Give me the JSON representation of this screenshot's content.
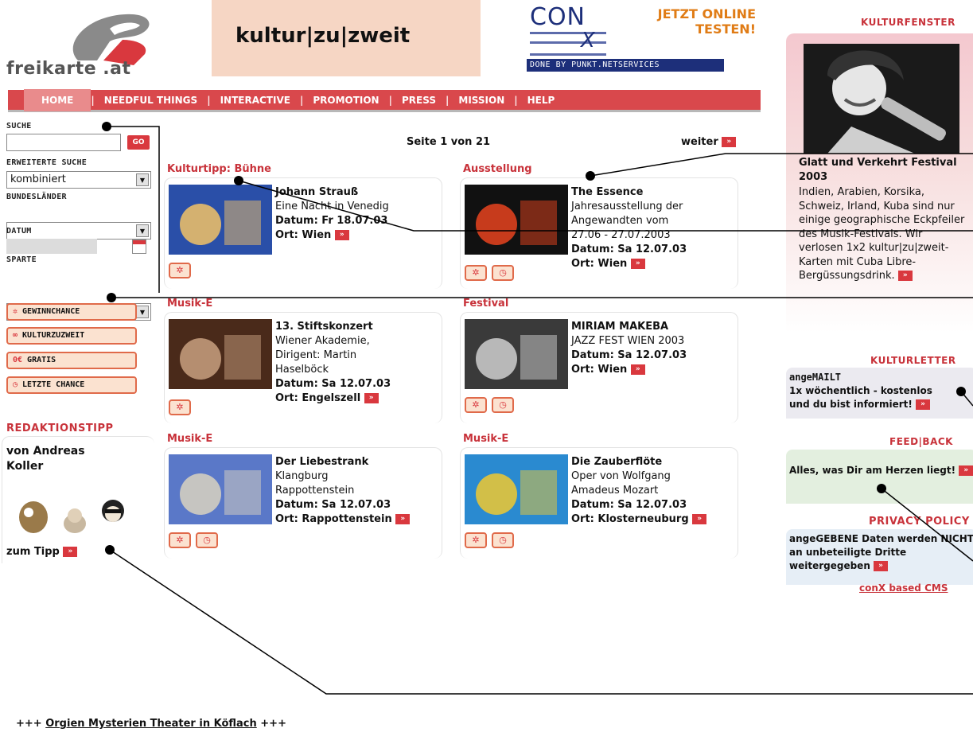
{
  "header": {
    "logo_text": "freikarte .at",
    "banner_text": "kultur|zu|zweit",
    "conx_brand": "CON",
    "conx_x": "X",
    "conx_slogan_line1": "JETZT ONLINE",
    "conx_slogan_line2": "TESTEN!",
    "conx_done_by": "DONE BY PUNKT.NETSERVICES"
  },
  "nav": {
    "items": [
      "HOME",
      "NEEDFUL THINGS",
      "INTERACTIVE",
      "PROMOTION",
      "PRESS",
      "MISSION",
      "HELP"
    ],
    "separator": "|"
  },
  "search": {
    "label": "SUCHE",
    "go_label": "GO",
    "ext_label": "ERWEITERTE SUCHE",
    "ext_value": "kombiniert",
    "bundes_label": "BUNDESLÄNDER",
    "datum_label": "DATUM",
    "sparte_label": "SPARTE"
  },
  "side_buttons": [
    "GEWINNCHANCE",
    "KULTURZUZWEIT",
    "GRATIS",
    "LETZTE CHANCE"
  ],
  "side_button_icons": [
    "star-icon",
    "glasses-icon",
    "ticket-icon",
    "clock-icon"
  ],
  "side_button_glyphs": {
    "star": "✲",
    "glasses": "∞",
    "euro": "0€",
    "clock": "◷"
  },
  "redaktion": {
    "heading": "REDAKTIONSTIPP",
    "author": "von Andreas Koller",
    "link": "zum Tipp"
  },
  "paging": {
    "page_text": "Seite 1 von 21",
    "next": "weiter"
  },
  "events": [
    {
      "category": "Kulturtipp: Bühne",
      "title": "Johann Strauß",
      "desc": [
        "Eine Nacht in Venedig"
      ],
      "date": "Datum: Fr 18.07.03",
      "place": "Ort: Wien",
      "colors": [
        "#2a4fa8",
        "#f2c266"
      ]
    },
    {
      "category": "Ausstellung",
      "title": "The Essence",
      "desc": [
        "Jahresausstellung der",
        "Angewandten vom",
        "27.06 - 27.07.2003"
      ],
      "date": "Datum: Sa 12.07.03",
      "place": "Ort: Wien",
      "colors": [
        "#111111",
        "#e8431e"
      ]
    },
    {
      "category": "Musik-E",
      "title": "13. Stiftskonzert",
      "desc": [
        "Wiener Akademie,",
        "Dirigent: Martin",
        "Haselböck"
      ],
      "date": "Datum: Sa 12.07.03",
      "place": "Ort: Engelszell",
      "colors": [
        "#4a2a1a",
        "#c8a080"
      ]
    },
    {
      "category": "Festival",
      "title": "MIRIAM MAKEBA",
      "desc": [
        "JAZZ FEST WIEN 2003"
      ],
      "date": "Datum: Sa 12.07.03",
      "place": "Ort: Wien",
      "colors": [
        "#3a3a3a",
        "#cfcfcf"
      ]
    },
    {
      "category": "Musik-E",
      "title": "Der Liebestrank",
      "desc": [
        "Klangburg",
        "Rappottenstein"
      ],
      "date": "Datum: Sa 12.07.03",
      "place": "Ort: Rappottenstein",
      "colors": [
        "#5a78c8",
        "#d9d2c0"
      ]
    },
    {
      "category": "Musik-E",
      "title": "Die Zauberflöte",
      "desc": [
        "Oper von Wolfgang",
        "Amadeus Mozart"
      ],
      "date": "Datum: Sa 12.07.03",
      "place": "Ort: Klosterneuburg",
      "colors": [
        "#2a8ad0",
        "#f0c830"
      ]
    }
  ],
  "right": {
    "kulturfenster_heading": "KULTURFENSTER",
    "feature_title": "Glatt und Verkehrt Festival 2003",
    "feature_text": "Indien, Arabien, Korsika, Schweiz, Irland, Kuba sind nur einige geographische Eckpfeiler des Musik-Festivals. Wir verlosen 1x2 kultur|zu|zweit-Karten mit Cuba Libre-Bergüssungsdrink.",
    "kulturletter_heading": "KULTURLETTER",
    "kulturletter_line1": "angeMAILT",
    "kulturletter_line2": "1x wöchentlich - kostenlos",
    "kulturletter_line3": "und du bist informiert!",
    "feedback_heading": "FEED|BACK",
    "feedback_text": "Alles, was Dir am Herzen liegt!",
    "privacy_heading": "PRIVACY POLICY",
    "privacy_text": "angeGEBENE Daten werden NICHT an unbeteiligte Dritte weitergegeben",
    "cms_link": "conX based CMS"
  },
  "ticker": {
    "prefix": "+++",
    "link": "Orgien Mysterien Theater in Köflach",
    "suffix": "+++"
  },
  "accent_color": "#d9383e"
}
